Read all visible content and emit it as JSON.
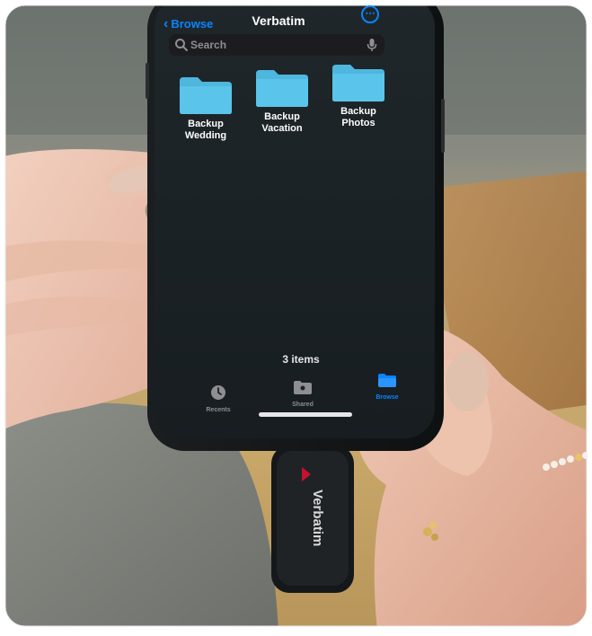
{
  "nav": {
    "back_label": "Browse",
    "title": "Verbatim"
  },
  "search": {
    "placeholder": "Search"
  },
  "folders": [
    {
      "label": "Backup\nWedding",
      "color": "#4fb6de"
    },
    {
      "label": "Backup\nVacation",
      "color": "#4fb6de"
    },
    {
      "label": "Backup\nPhotos",
      "color": "#4fb6de"
    }
  ],
  "item_count": "3 items",
  "tabs": [
    {
      "label": "Recents",
      "icon": "clock-icon"
    },
    {
      "label": "Shared",
      "icon": "shared-folder-icon"
    },
    {
      "label": "Browse",
      "icon": "folder-icon",
      "active": true
    }
  ],
  "usb_drive": {
    "brand": "Verbatim"
  },
  "colors": {
    "accent": "#0a84ff",
    "screen_bg": "#1b2226"
  }
}
